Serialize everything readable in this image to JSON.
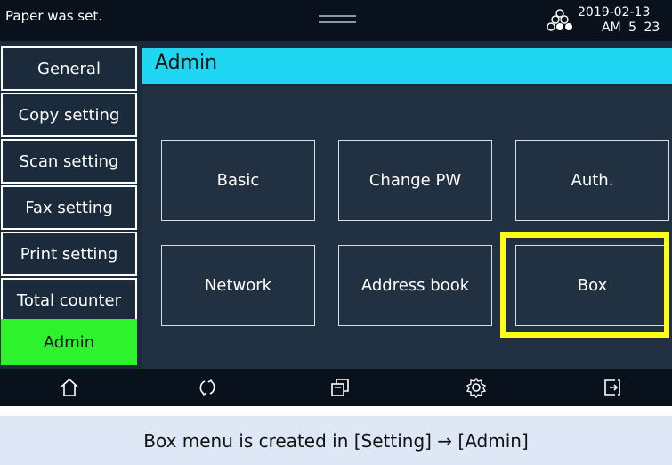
{
  "status_bar": {
    "message": "Paper was set.",
    "date": "2019-02-13",
    "time": "AM 5 23",
    "icon": "toner-dots-icon"
  },
  "sidebar": {
    "items": [
      {
        "label": "General",
        "active": false
      },
      {
        "label": "Copy setting",
        "active": false
      },
      {
        "label": "Scan setting",
        "active": false
      },
      {
        "label": "Fax setting",
        "active": false
      },
      {
        "label": "Print setting",
        "active": false
      },
      {
        "label": "Total counter",
        "active": false
      },
      {
        "label": "Admin",
        "active": true
      }
    ]
  },
  "main": {
    "title": "Admin",
    "buttons": [
      {
        "label": "Basic"
      },
      {
        "label": "Change PW"
      },
      {
        "label": "Auth."
      },
      {
        "label": "Network"
      },
      {
        "label": "Address book"
      },
      {
        "label": "Box"
      }
    ]
  },
  "bottom_nav": {
    "items": [
      "home-icon",
      "refresh-icon",
      "copy-icon",
      "settings-gear-icon",
      "logout-icon"
    ]
  },
  "caption": "Box menu is created in [Setting] → [Admin]",
  "colors": {
    "title_bar": "#1fd6f2",
    "active_item": "#2ff22f",
    "highlight": "#ffff11",
    "screen_bg": "#1b2b3c",
    "caption_bg": "#dde7f5"
  }
}
